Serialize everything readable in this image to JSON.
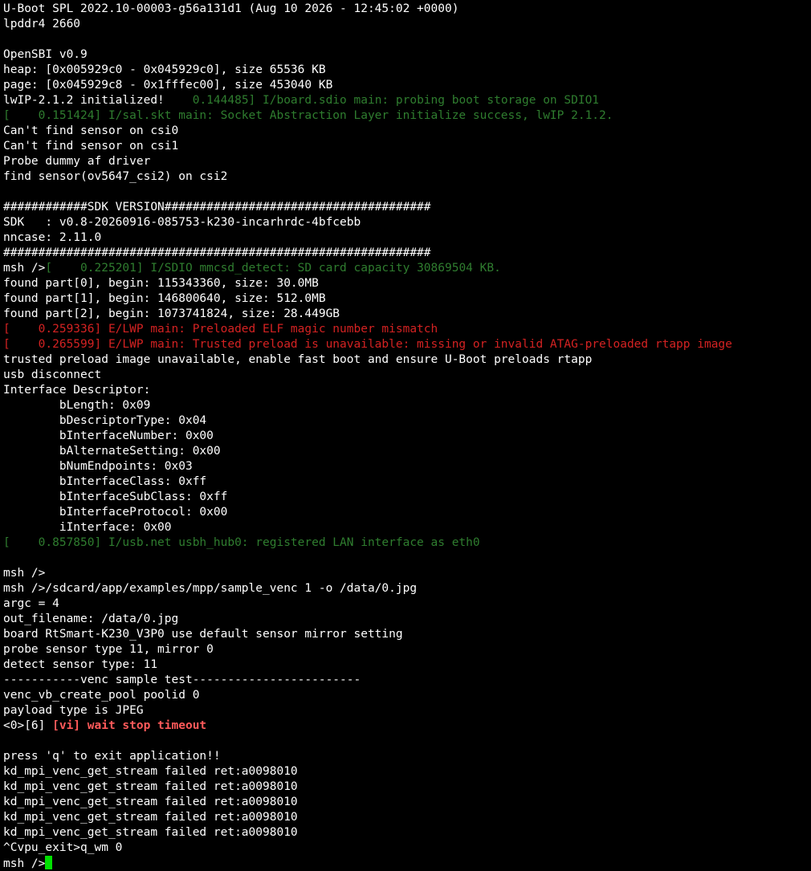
{
  "colors": {
    "background": "#000000",
    "default": "#ffffff",
    "green": "#2f7d2f",
    "red": "#d42222",
    "boldred": "#ff5a5a",
    "cursor": "#00e000"
  },
  "lines": [
    [
      {
        "t": "U-Boot SPL 2022.10-00003-g56a131d1 (Aug 10 2026 - 12:45:02 +0000)",
        "c": "default"
      }
    ],
    [
      {
        "t": "lpddr4 2660",
        "c": "default"
      }
    ],
    [],
    [
      {
        "t": "OpenSBI v0.9",
        "c": "default"
      }
    ],
    [
      {
        "t": "heap: [0x005929c0 - 0x045929c0], size 65536 KB",
        "c": "default"
      }
    ],
    [
      {
        "t": "page: [0x045929c8 - 0x1fffec00], size 453040 KB",
        "c": "default"
      }
    ],
    [
      {
        "t": "lwIP-2.1.2 initialized!",
        "c": "default"
      },
      {
        "t": "    0.144485] I/board.sdio main: probing boot storage on SDIO1",
        "c": "green"
      }
    ],
    [
      {
        "t": "[    0.151424] I/sal.skt main: Socket Abstraction Layer initialize success, lwIP 2.1.2.",
        "c": "green"
      }
    ],
    [
      {
        "t": "Can't find sensor on csi0",
        "c": "default"
      }
    ],
    [
      {
        "t": "Can't find sensor on csi1",
        "c": "default"
      }
    ],
    [
      {
        "t": "Probe dummy af driver",
        "c": "default"
      }
    ],
    [
      {
        "t": "find sensor(ov5647_csi2) on csi2",
        "c": "default"
      }
    ],
    [],
    [
      {
        "t": "############SDK VERSION######################################",
        "c": "default"
      }
    ],
    [
      {
        "t": "SDK   : v0.8-20260916-085753-k230-incarhrdc-4bfcebb",
        "c": "default"
      }
    ],
    [
      {
        "t": "nncase: 2.11.0",
        "c": "default"
      }
    ],
    [
      {
        "t": "#############################################################",
        "c": "default"
      }
    ],
    [
      {
        "t": "msh />",
        "c": "default"
      },
      {
        "t": "[    0.225201] I/SDIO mmcsd_detect: SD card capacity 30869504 KB.",
        "c": "green"
      }
    ],
    [
      {
        "t": "found part[0], begin: 115343360, size: 30.0MB",
        "c": "default"
      }
    ],
    [
      {
        "t": "found part[1], begin: 146800640, size: 512.0MB",
        "c": "default"
      }
    ],
    [
      {
        "t": "found part[2], begin: 1073741824, size: 28.449GB",
        "c": "default"
      }
    ],
    [
      {
        "t": "[    0.259336] E/LWP main: Preloaded ELF magic number mismatch",
        "c": "red"
      }
    ],
    [
      {
        "t": "[    0.265599] E/LWP main: Trusted preload is unavailable: missing or invalid ATAG-preloaded rtapp image",
        "c": "red"
      }
    ],
    [
      {
        "t": "trusted preload image unavailable, enable fast boot and ensure U-Boot preloads rtapp",
        "c": "default"
      }
    ],
    [
      {
        "t": "usb disconnect",
        "c": "default"
      }
    ],
    [
      {
        "t": "Interface Descriptor:",
        "c": "default"
      }
    ],
    [
      {
        "t": "        bLength: 0x09",
        "c": "default"
      }
    ],
    [
      {
        "t": "        bDescriptorType: 0x04",
        "c": "default"
      }
    ],
    [
      {
        "t": "        bInterfaceNumber: 0x00",
        "c": "default"
      }
    ],
    [
      {
        "t": "        bAlternateSetting: 0x00",
        "c": "default"
      }
    ],
    [
      {
        "t": "        bNumEndpoints: 0x03",
        "c": "default"
      }
    ],
    [
      {
        "t": "        bInterfaceClass: 0xff",
        "c": "default"
      }
    ],
    [
      {
        "t": "        bInterfaceSubClass: 0xff",
        "c": "default"
      }
    ],
    [
      {
        "t": "        bInterfaceProtocol: 0x00",
        "c": "default"
      }
    ],
    [
      {
        "t": "        iInterface: 0x00",
        "c": "default"
      }
    ],
    [
      {
        "t": "[    0.857850] I/usb.net usbh_hub0: registered LAN interface as eth0",
        "c": "green"
      }
    ],
    [],
    [
      {
        "t": "msh />",
        "c": "default"
      }
    ],
    [
      {
        "t": "msh />/sdcard/app/examples/mpp/sample_venc 1 -o /data/0.jpg",
        "c": "default"
      }
    ],
    [
      {
        "t": "argc = 4",
        "c": "default"
      }
    ],
    [
      {
        "t": "out_filename: /data/0.jpg",
        "c": "default"
      }
    ],
    [
      {
        "t": "board RtSmart-K230_V3P0 use default sensor mirror setting",
        "c": "default"
      }
    ],
    [
      {
        "t": "probe sensor type 11, mirror 0",
        "c": "default"
      }
    ],
    [
      {
        "t": "detect sensor type: 11",
        "c": "default"
      }
    ],
    [
      {
        "t": "-----------venc sample test------------------------",
        "c": "default"
      }
    ],
    [
      {
        "t": "venc_vb_create_pool poolid 0",
        "c": "default"
      }
    ],
    [
      {
        "t": "payload type is JPEG",
        "c": "default"
      }
    ],
    [
      {
        "t": "<0>[6] ",
        "c": "default"
      },
      {
        "t": "[vi] wait stop timeout",
        "c": "boldred"
      }
    ],
    [],
    [
      {
        "t": "press 'q' to exit application!!",
        "c": "default"
      }
    ],
    [
      {
        "t": "kd_mpi_venc_get_stream failed ret:a0098010",
        "c": "default"
      }
    ],
    [
      {
        "t": "kd_mpi_venc_get_stream failed ret:a0098010",
        "c": "default"
      }
    ],
    [
      {
        "t": "kd_mpi_venc_get_stream failed ret:a0098010",
        "c": "default"
      }
    ],
    [
      {
        "t": "kd_mpi_venc_get_stream failed ret:a0098010",
        "c": "default"
      }
    ],
    [
      {
        "t": "kd_mpi_venc_get_stream failed ret:a0098010",
        "c": "default"
      }
    ],
    [
      {
        "t": "^Cvpu_exit>q_wm 0",
        "c": "default"
      }
    ],
    [
      {
        "t": "msh />",
        "c": "default"
      }
    ]
  ]
}
